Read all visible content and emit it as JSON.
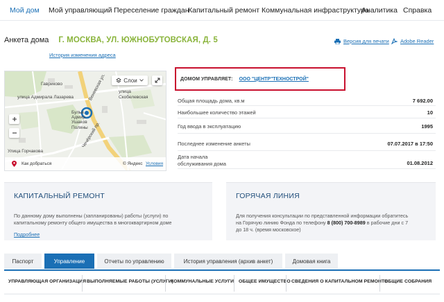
{
  "nav": {
    "items": [
      {
        "label": "Мой дом",
        "active": true
      },
      {
        "label": "Мой управляющий",
        "active": false
      },
      {
        "label": "Переселение граждан",
        "active": false
      },
      {
        "label": "Капитальный ремонт",
        "active": false
      },
      {
        "label": "Коммунальная инфраструктура",
        "active": false
      },
      {
        "label": "Аналитика",
        "active": false
      },
      {
        "label": "Справка",
        "active": false
      }
    ]
  },
  "header": {
    "label": "Анкета дома",
    "address": "Г. МОСКВА, УЛ. ЮЖНОБУТОВСКАЯ, Д. 5",
    "history_link": "История изменения адреса",
    "print_link": "Версия для печати",
    "reader_link": "Adobe Reader"
  },
  "map": {
    "layers_label": "Слои",
    "route_label": "Как добраться",
    "yandex_label": "© Яндекс",
    "terms_label": "Условия",
    "labels": {
      "gavrikovo": "Гавриково",
      "adm_lazareva": "улица Адмирала Лазарева",
      "ul_skobelevskaya": "улица Скобелевская",
      "venevskaya": "Веневская ул.",
      "bulvar": "Бульв. Адмир. Ушаков",
      "polyany": "Поляны",
      "goricheva": "Улица Горчакова",
      "chechersky": "Чечёрский пр."
    }
  },
  "manager": {
    "key": "ДОМОМ УПРАВЛЯЕТ:",
    "value": "ООО \"ЦЕНТР\"ТЕХНОСТРОЙ\""
  },
  "info": {
    "rows": [
      {
        "key": "Общая площадь дома, кв.м",
        "value": "7 692.00"
      },
      {
        "key": "Наибольшее количество этажей",
        "value": "10"
      },
      {
        "key": "Год ввода в эксплуатацию",
        "value": "1995"
      },
      {
        "key": "Последнее изменение анкеты",
        "value": "07.07.2017 в 17:50"
      },
      {
        "key": "Дата начала обслуживания дома",
        "value": "01.08.2012"
      }
    ]
  },
  "capital": {
    "title": "КАПИТАЛЬНЫЙ РЕМОНТ",
    "text1": "По данному дому выполнены (запланированы) работы (услуги) по",
    "text2": "капитальному ремонту общего имущества в многоквартирном доме",
    "more": "Подробнее"
  },
  "hotline": {
    "title": "ГОРЯЧАЯ ЛИНИЯ",
    "text1": "Для получения консультации по представленной информации обратитесь",
    "text2a": "на Горячую линию Фонда по телефону ",
    "phone": "8 (800) 700-8989",
    "text2b": " в рабочие дни с 7",
    "text3": "до 18 ч. (время московское)"
  },
  "tabs": [
    {
      "label": "Паспорт",
      "active": false
    },
    {
      "label": "Управление",
      "active": true
    },
    {
      "label": "Отчеты по управлению",
      "active": false
    },
    {
      "label": "История управления (архив анкет)",
      "active": false
    },
    {
      "label": "Домовая книга",
      "active": false
    }
  ],
  "subtabs": [
    {
      "label": "УПРАВЛЯЮЩАЯ ОРГАНИЗАЦИЯ"
    },
    {
      "label": "ВЫПОЛНЯЕМЫЕ РАБОТЫ (УСЛУГИ)"
    },
    {
      "label": "КОММУНАЛЬНЫЕ УСЛУГИ"
    },
    {
      "label": "ОБЩЕЕ ИМУЩЕСТВО"
    },
    {
      "label": "СВЕДЕНИЯ О КАПИТАЛЬНОМ РЕМОНТЕ"
    },
    {
      "label": "ОБЩИЕ СОБРАНИЯ"
    }
  ],
  "colors": {
    "accent": "#1a6fb5",
    "address": "#8ab43c",
    "highlight_border": "#c8102e"
  }
}
